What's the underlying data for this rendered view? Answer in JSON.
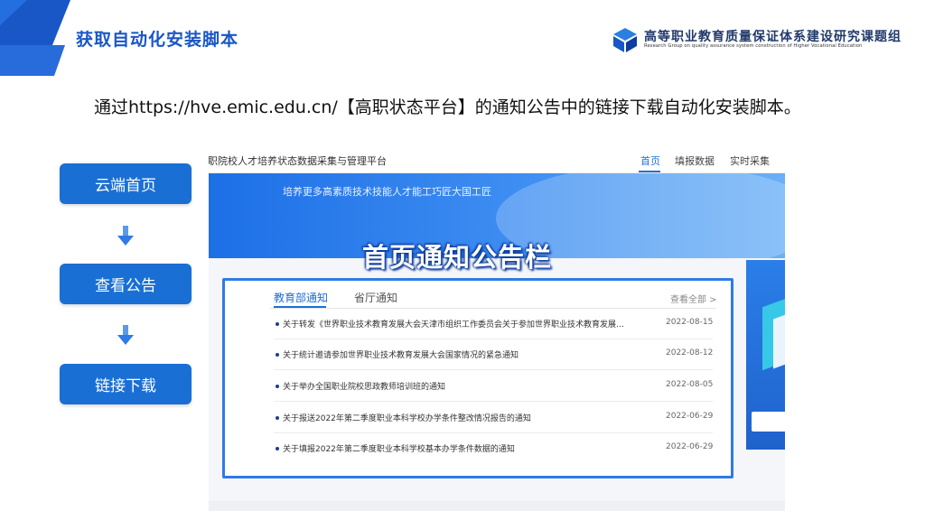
{
  "slide": {
    "title": "获取自动化安装脚本",
    "org_name": "高等职业教育质量保证体系建设研究课题组",
    "org_subtitle": "Research Group on quality assurance system construction of Higher Vocational Education",
    "instruction": "通过https://hve.emic.edu.cn/【高职状态平台】的通知公告中的链接下载自动化安装脚本。"
  },
  "steps": [
    {
      "label": "云端首页"
    },
    {
      "label": "查看公告"
    },
    {
      "label": "链接下载"
    }
  ],
  "screenshot": {
    "platform_title": "高职院校人才培养状态数据采集与管理平台",
    "nav": [
      {
        "label": "首页",
        "active": true
      },
      {
        "label": "填报数据",
        "active": false
      },
      {
        "label": "实时采集",
        "active": false
      }
    ],
    "slogan": "培养更多高素质技术技能人才能工巧匠大国工匠",
    "overlay_label": "首页通知公告栏",
    "tabs": [
      {
        "label": "教育部通知",
        "active": true
      },
      {
        "label": "省厅通知",
        "active": false
      }
    ],
    "more_label": "查看全部 >",
    "notices": [
      {
        "title": "关于转发《世界职业技术教育发展大会天津市组织工作委员会关于参加世界职业技术教育发展大会...",
        "date": "2022-08-15"
      },
      {
        "title": "关于统计邀请参加世界职业技术教育发展大会国家情况的紧急通知",
        "date": "2022-08-12"
      },
      {
        "title": "关于举办全国职业院校思政教师培训班的通知",
        "date": "2022-08-05"
      },
      {
        "title": "关于报送2022年第二季度职业本科学校办学条件整改情况报告的通知",
        "date": "2022-06-29"
      },
      {
        "title": "关于填报2022年第二季度职业本科学校基本办学条件数据的通知",
        "date": "2022-06-29"
      }
    ]
  },
  "colors": {
    "accent": "#1a6fd4",
    "title_blue": "#1a57c6",
    "card_border": "#2f7ae5"
  },
  "icons": [
    "cube-logo-icon",
    "arrow-down-icon",
    "bullet-icon",
    "chevron-right-icon"
  ]
}
